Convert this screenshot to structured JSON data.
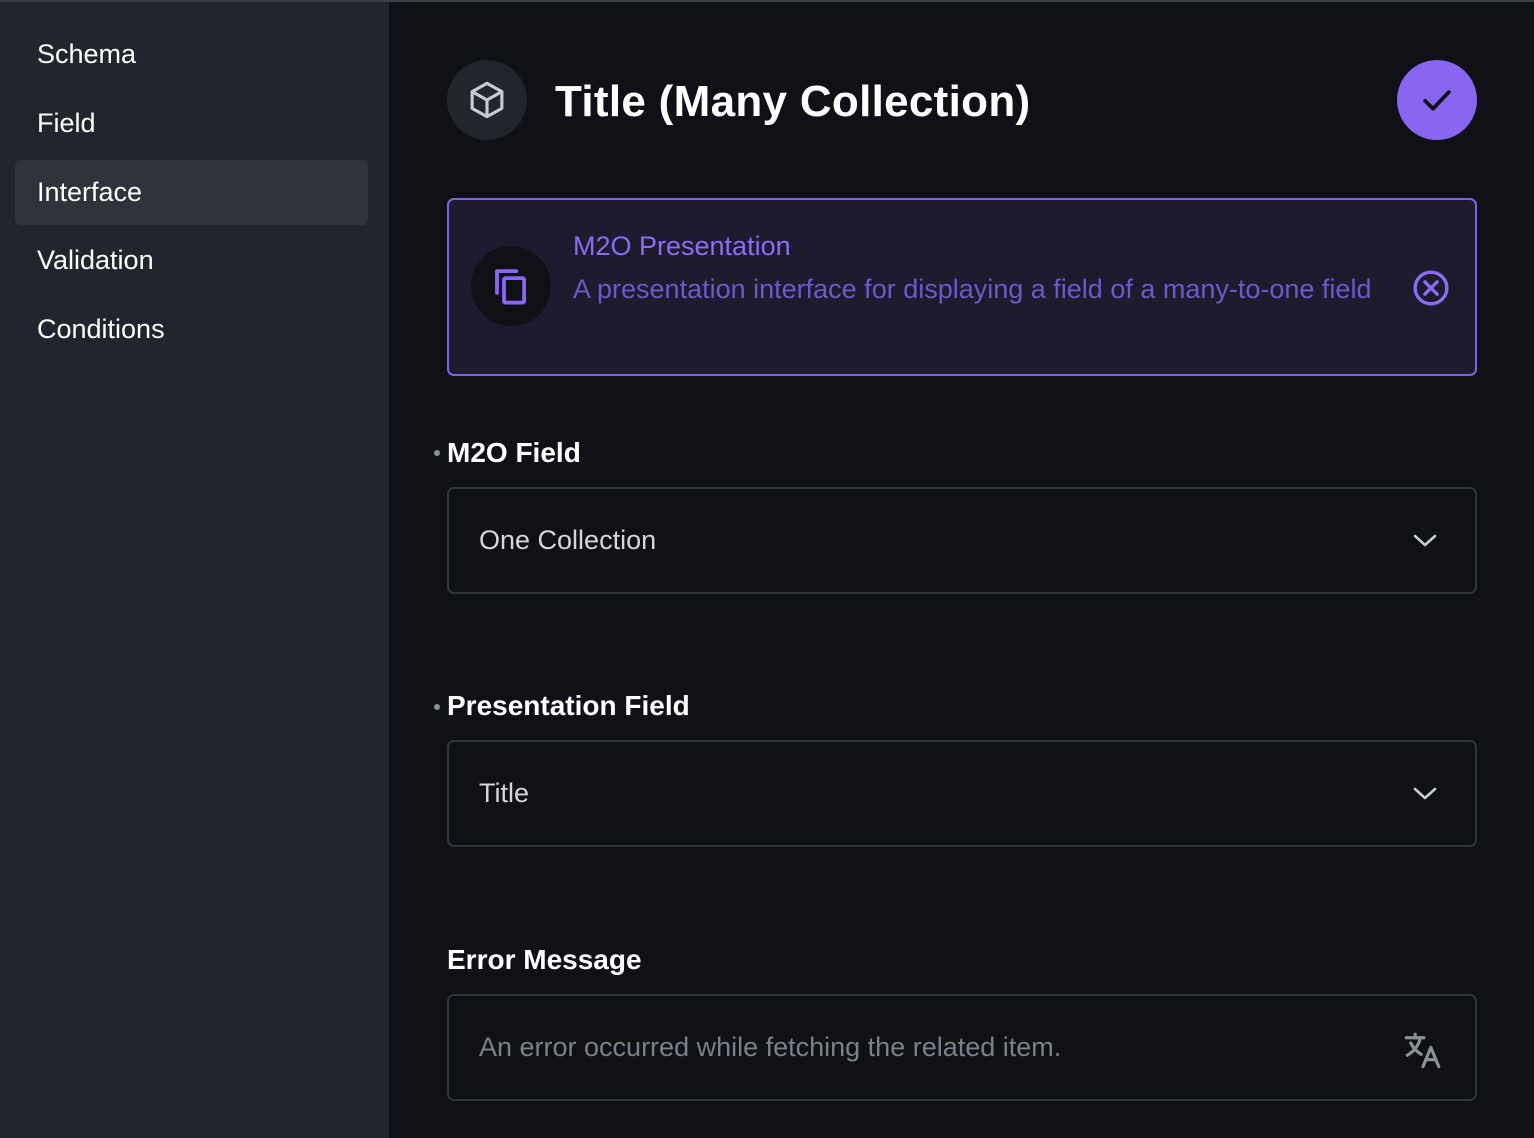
{
  "sidebar": {
    "items": [
      {
        "label": "Schema"
      },
      {
        "label": "Field"
      },
      {
        "label": "Interface"
      },
      {
        "label": "Validation"
      },
      {
        "label": "Conditions"
      }
    ],
    "active": "Interface"
  },
  "header": {
    "icon": "cube-icon",
    "title": "Title (Many Collection)",
    "save_icon": "check-icon"
  },
  "interface_card": {
    "icon": "copy-icon",
    "name": "M2O Presentation",
    "description": "A presentation interface for displaying a field of a many-to-one field",
    "remove_icon": "close-circle-icon"
  },
  "fields": {
    "m2o_field": {
      "label": "M2O Field",
      "value": "One Collection",
      "required": true
    },
    "presentation_field": {
      "label": "Presentation Field",
      "value": "Title",
      "required": true
    },
    "error_message": {
      "label": "Error Message",
      "placeholder": "An error occurred while fetching the related item.",
      "icon": "translate-icon"
    }
  },
  "colors": {
    "accent": "#8866f2",
    "sidebar_bg": "#21252d",
    "main_bg": "#0f1116"
  }
}
